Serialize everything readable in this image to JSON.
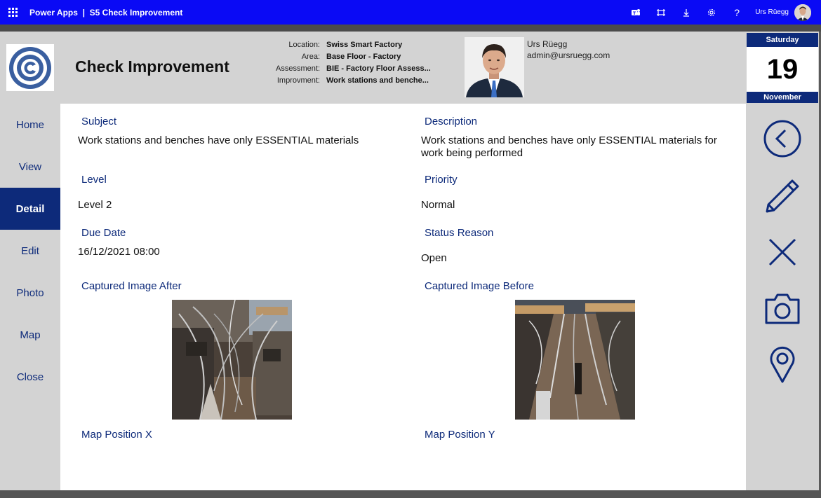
{
  "header": {
    "product": "Power Apps",
    "separator": "|",
    "app_name": "S5 Check Improvement",
    "user_name": "Urs Rüegg",
    "icons": [
      "waffle-icon",
      "teams-icon",
      "fit-screen-icon",
      "download-icon",
      "gear-icon",
      "help-icon"
    ],
    "help_glyph": "?"
  },
  "page": {
    "title": "Check Improvement"
  },
  "info": {
    "location_label": "Location:",
    "location_value": "Swiss Smart Factory",
    "area_label": "Area:",
    "area_value": "Base Floor - Factory",
    "assessment_label": "Assessment:",
    "assessment_value": "BIE - Factory Floor Assess...",
    "improvement_label": "Improvment:",
    "improvement_value": "Work stations and benche..."
  },
  "person": {
    "name": "Urs Rüegg",
    "email": "admin@ursruegg.com"
  },
  "date": {
    "weekday": "Saturday",
    "day": "19",
    "month": "November"
  },
  "nav": {
    "items": [
      {
        "label": "Home",
        "active": false
      },
      {
        "label": "View",
        "active": false
      },
      {
        "label": "Detail",
        "active": true
      },
      {
        "label": "Edit",
        "active": false
      },
      {
        "label": "Photo",
        "active": false
      },
      {
        "label": "Map",
        "active": false
      },
      {
        "label": "Close",
        "active": false
      }
    ]
  },
  "fields": {
    "subject_label": "Subject",
    "subject_value": "Work stations and benches have only ESSENTIAL materials",
    "description_label": "Description",
    "description_value": "Work stations and benches have only ESSENTIAL materials for work being performed",
    "level_label": "Level",
    "level_value": "Level 2",
    "priority_label": "Priority",
    "priority_value": "Normal",
    "due_label": "Due Date",
    "due_value": "16/12/2021 08:00",
    "status_label": "Status Reason",
    "status_value": "Open",
    "image_after_label": "Captured Image After",
    "image_before_label": "Captured Image Before",
    "map_x_label": "Map Position X",
    "map_y_label": "Map Position Y"
  },
  "actions": [
    "back-icon",
    "edit-pencil-icon",
    "close-icon",
    "camera-icon",
    "map-pin-icon"
  ],
  "colors": {
    "header_blue": "#0a0af5",
    "navy": "#0d2a7a",
    "panel_gray": "#d3d3d3"
  }
}
